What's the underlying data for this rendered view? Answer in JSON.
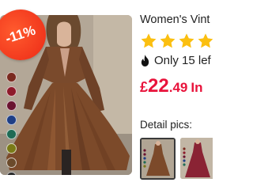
{
  "product": {
    "title": "Women's Vint",
    "discount_badge": "-11%",
    "rating_stars": 4,
    "stock_text": "Only 15 lef",
    "price": {
      "currency": "£",
      "integer": "22",
      "decimal": ".49",
      "after": "In"
    },
    "detail_label": "Detail pics:",
    "swatch_colors": [
      "#7a2a1f",
      "#8e1a2a",
      "#6a1330",
      "#1f3f86",
      "#1e6b55",
      "#7a7a18",
      "#6b4a2b",
      "#2a2a2a"
    ]
  },
  "colors": {
    "star": "#fbbf10",
    "price": "#e8133b",
    "badge": "#f2381d"
  }
}
